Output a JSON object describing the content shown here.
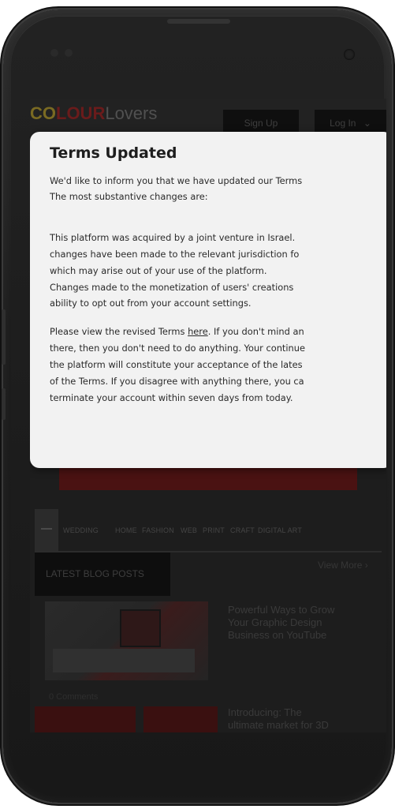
{
  "site": {
    "logo": {
      "part1": "CO",
      "part2": "LOUR",
      "part3": "Lovers"
    },
    "header": {
      "signup_label": "Sign Up",
      "login_label": "Log In"
    },
    "categories": [
      "WEDDING",
      "HOME",
      "FASHION",
      "WEB",
      "PRINT",
      "CRAFT",
      "DIGITAL ART"
    ],
    "latest_tab_label": "LATEST BLOG POSTS",
    "view_more_label": "View More ›",
    "posts": [
      {
        "title_line1": "Powerful Ways to Grow",
        "title_line2": "Your Graphic Design",
        "title_line3": "Business on YouTube"
      },
      {
        "title_line1": "Introducing: The",
        "title_line2": "ultimate market for 3D"
      }
    ],
    "comments_label": "0 Comments"
  },
  "modal": {
    "title": "Terms Updated",
    "para1": {
      "line1": "We'd like to inform you that we have updated our Terms",
      "line2": "The most substantive changes are:"
    },
    "para2": {
      "line1": "This platform was acquired by a joint venture in Israel.",
      "line2": "changes have been made to the relevant jurisdiction fo",
      "line3": "which may arise out of your use of the platform.",
      "line4": "Changes made to the monetization of users' creations",
      "line5": "ability to opt out from your account settings."
    },
    "para3": {
      "line1_pre": "Please view the revised Terms ",
      "link": "here",
      "line1_post": ". If you don't mind an",
      "line2": "there, then you don't need to do anything. Your continue",
      "line3": "the platform will constitute your acceptance of the lates",
      "line4": "of the Terms. If you disagree with anything there, you ca",
      "line5": "terminate your account within seven days from today."
    }
  }
}
